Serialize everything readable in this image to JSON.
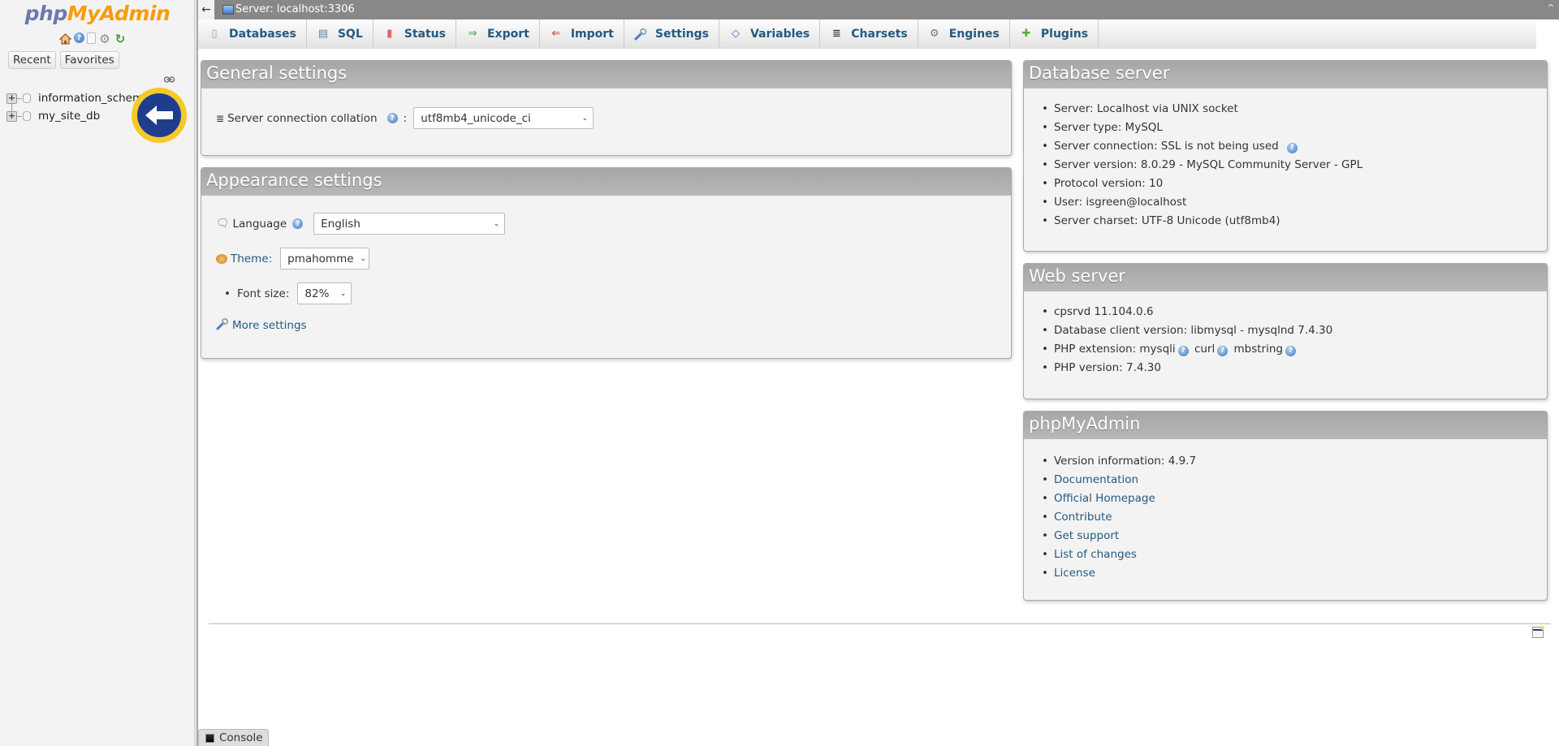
{
  "sidebar": {
    "logo": {
      "part1": "php",
      "part2": "MyAdmin"
    },
    "quick_icons": [
      "home-icon",
      "help-icon",
      "docs-icon",
      "settings-icon",
      "reload-icon"
    ],
    "buttons": {
      "recent": "Recent",
      "favorites": "Favorites"
    },
    "databases": [
      {
        "name": "information_schema"
      },
      {
        "name": "my_site_db"
      }
    ]
  },
  "topbar": {
    "back_glyph": "←",
    "server_label": "Server: localhost:3306",
    "collapse_glyph": "⌃"
  },
  "tabs": [
    {
      "label": "Databases",
      "icon": "database-icon",
      "glyph": "▯"
    },
    {
      "label": "SQL",
      "icon": "sql-icon",
      "glyph": "▤"
    },
    {
      "label": "Status",
      "icon": "status-icon",
      "glyph": "▮"
    },
    {
      "label": "Export",
      "icon": "export-icon",
      "glyph": "⇒"
    },
    {
      "label": "Import",
      "icon": "import-icon",
      "glyph": "⇐"
    },
    {
      "label": "Settings",
      "icon": "wrench-icon",
      "glyph": "🔧"
    },
    {
      "label": "Variables",
      "icon": "variables-icon",
      "glyph": "◇"
    },
    {
      "label": "Charsets",
      "icon": "charsets-icon",
      "glyph": "≣"
    },
    {
      "label": "Engines",
      "icon": "engines-icon",
      "glyph": "⚙"
    },
    {
      "label": "Plugins",
      "icon": "plugin-icon",
      "glyph": "✚"
    }
  ],
  "general_settings": {
    "title": "General settings",
    "collation_label": "Server connection collation",
    "colon": ":",
    "collation_value": "utf8mb4_unicode_ci"
  },
  "appearance_settings": {
    "title": "Appearance settings",
    "language_label": "Language",
    "language_value": "English",
    "theme_label": "Theme:",
    "theme_value": "pmahomme",
    "font_size_label": "Font size:",
    "font_size_value": "82%",
    "more_settings": "More settings"
  },
  "database_server": {
    "title": "Database server",
    "items": [
      "Server: Localhost via UNIX socket",
      "Server type: MySQL",
      "Server connection: SSL is not being used",
      "Server version: 8.0.29 - MySQL Community Server - GPL",
      "Protocol version: 10",
      "User: isgreen@localhost",
      "Server charset: UTF-8 Unicode (utf8mb4)"
    ]
  },
  "web_server": {
    "title": "Web server",
    "items": [
      "cpsrvd 11.104.0.6",
      "Database client version: libmysql - mysqlnd 7.4.30"
    ],
    "php_ext_label": "PHP extension:",
    "php_exts": [
      "mysqli",
      "curl",
      "mbstring"
    ],
    "php_version": "PHP version: 7.4.30"
  },
  "phpmyadmin": {
    "title": "phpMyAdmin",
    "version": "Version information: 4.9.7",
    "links": [
      "Documentation",
      "Official Homepage",
      "Contribute",
      "Get support",
      "List of changes",
      "License"
    ]
  },
  "console": {
    "label": "Console"
  },
  "help_glyph": "?"
}
